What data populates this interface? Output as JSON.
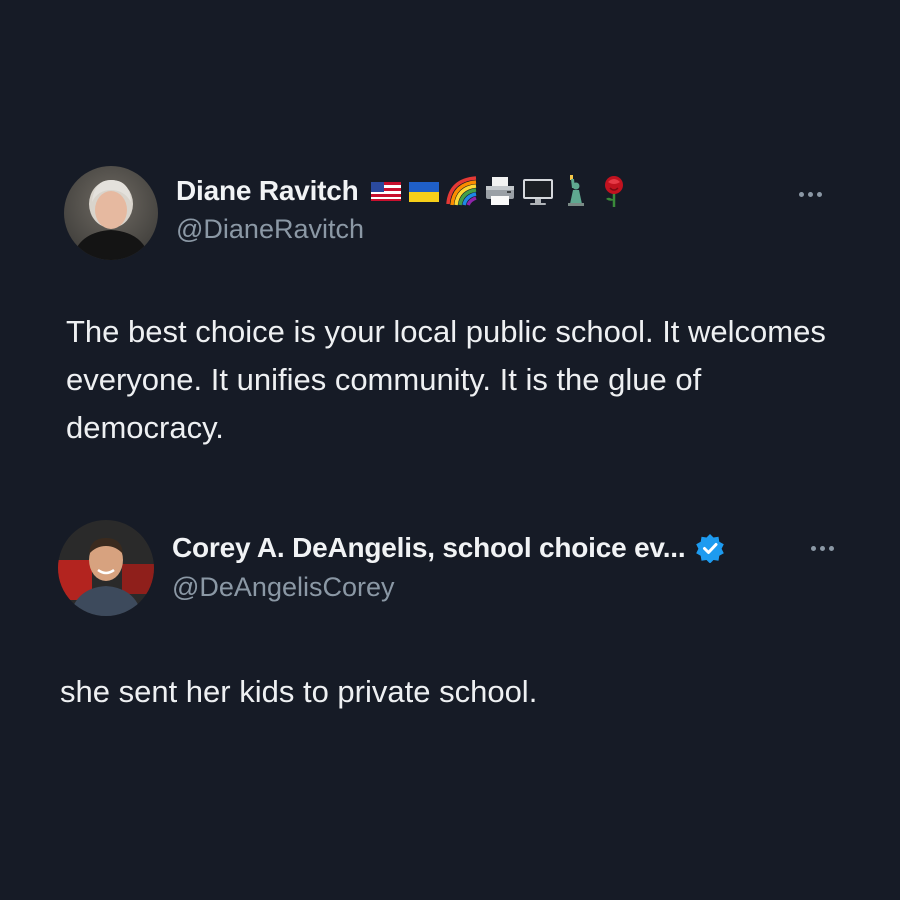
{
  "tweets": [
    {
      "display_name": "Diane Ravitch",
      "handle": "@DianeRavitch",
      "name_emojis": [
        "us-flag-icon",
        "ukraine-flag-icon",
        "rainbow-icon",
        "printer-icon",
        "desktop-computer-icon",
        "statue-of-liberty-icon",
        "rose-icon"
      ],
      "text": "The best choice is your local public school. It welcomes everyone. It unifies community. It is the glue of democracy.",
      "more_icon": "more-dots-icon"
    },
    {
      "display_name": "Corey A. DeAngelis, school choice ev...",
      "handle": "@DeAngelisCorey",
      "verified_icon": "verified-badge-icon",
      "text": "she sent her kids to private school.",
      "more_icon": "more-dots-icon"
    }
  ],
  "colors": {
    "background": "#161b26",
    "text_primary": "#eef0f2",
    "text_secondary": "#8b98a5",
    "verified_blue": "#1d9bf0"
  }
}
